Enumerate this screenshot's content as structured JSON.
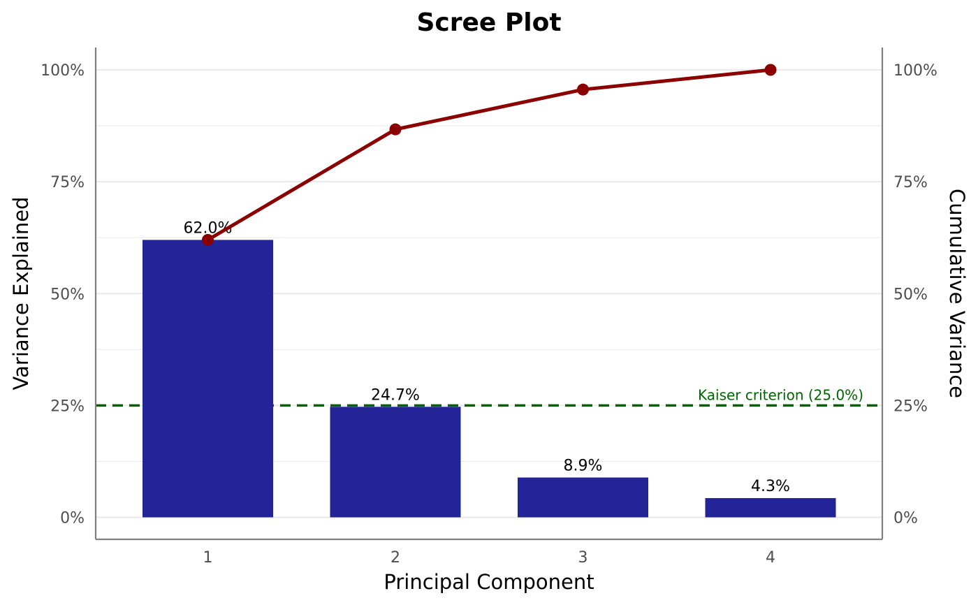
{
  "chart_data": {
    "type": "bar",
    "title": "Scree Plot",
    "xlabel": "Principal Component",
    "ylabel": "Variance Explained",
    "ylabel_right": "Cumulative Variance",
    "categories": [
      "1",
      "2",
      "3",
      "4"
    ],
    "ylim": [
      0,
      100
    ],
    "y_ticks": [
      "0%",
      "25%",
      "50%",
      "75%",
      "100%"
    ],
    "y_tick_values": [
      0,
      25,
      50,
      75,
      100
    ],
    "y_minor_values": [
      12.5,
      37.5,
      62.5,
      87.5
    ],
    "series": [
      {
        "type": "bar",
        "values": [
          62.0,
          24.7,
          8.9,
          4.3
        ],
        "data_labels": [
          "62.0%",
          "24.7%",
          "8.9%",
          "4.3%"
        ],
        "color": "#242499"
      },
      {
        "type": "line",
        "axis": "right",
        "values": [
          62.0,
          86.7,
          95.6,
          100.0
        ],
        "color": "#8b0000"
      }
    ],
    "reference_line": {
      "value": 25.0,
      "label": "Kaiser criterion (25.0%)",
      "style": "dashed",
      "color": "#006400"
    },
    "grid": true,
    "legend": "none"
  },
  "colors": {
    "grid": "#ebebeb",
    "axis": "#7f7f7f"
  }
}
